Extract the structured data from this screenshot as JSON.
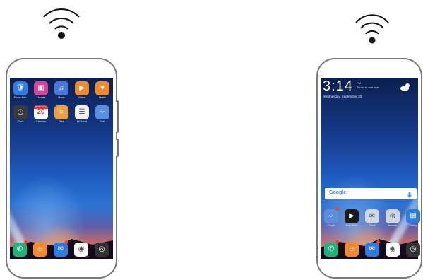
{
  "icons": {
    "wifi": "wifi-icon",
    "weather": "cloud-sun-icon",
    "mic": "microphone-icon"
  },
  "left_phone": {
    "apps_row1": [
      {
        "label": "Phone Man.",
        "icon": "shield-icon",
        "color": "#2f7de1"
      },
      {
        "label": "Themes",
        "icon": "themes-icon",
        "color": "#d6459a"
      },
      {
        "label": "Music",
        "icon": "music-icon",
        "color": "#4a78d8"
      },
      {
        "label": "Videos",
        "icon": "play-icon",
        "color": "#f08a2c"
      },
      {
        "label": "Health",
        "icon": "heart-icon",
        "color": "#f08a2c"
      }
    ],
    "apps_row2": [
      {
        "label": "Clock",
        "icon": "clock-icon",
        "color": "#3a3a3a"
      },
      {
        "label": "Calendar",
        "icon": "calendar-icon",
        "color": "#ffffff",
        "glyph_top": "Wednesday",
        "glyph": "20"
      },
      {
        "label": "Files",
        "icon": "folder-icon",
        "color": "#f0a03a"
      },
      {
        "label": "Hi Board",
        "icon": "notepad-icon",
        "color": "#f2f2f2"
      },
      {
        "label": "Tools",
        "icon": "tools-folder-icon",
        "color": "#5a8fe0"
      }
    ],
    "dock": [
      {
        "icon": "phone-call-icon",
        "color": "#23b07a"
      },
      {
        "icon": "contacts-icon",
        "color": "#f08a2c"
      },
      {
        "icon": "messages-icon",
        "color": "#2f7de1"
      },
      {
        "icon": "chrome-icon",
        "color": "#ffffff"
      },
      {
        "icon": "camera-icon",
        "color": "#333333"
      }
    ]
  },
  "right_phone": {
    "time": "3:14",
    "time_suffix": "PM",
    "unlock_hint": "Touch to add lock",
    "date": "Wednesday, September 20",
    "search_brand": "Google",
    "apps_row": [
      {
        "label": "Google",
        "icon": "google-folder-icon",
        "color": "#5a8fe0"
      },
      {
        "label": "Play Store",
        "icon": "play-store-icon",
        "color": "#1a1a1a"
      },
      {
        "label": "Email",
        "icon": "mail-icon",
        "color": "#cfd6e4"
      },
      {
        "label": "Browser",
        "icon": "browser-icon",
        "color": "#cfd6e4"
      },
      {
        "label": "Gallery",
        "icon": "gallery-icon",
        "color": "#2f7de1"
      }
    ],
    "dock": [
      {
        "icon": "phone-call-icon",
        "color": "#23b07a"
      },
      {
        "icon": "contacts-icon",
        "color": "#f08a2c"
      },
      {
        "icon": "messages-icon",
        "color": "#2f7de1"
      },
      {
        "icon": "chrome-icon",
        "color": "#ffffff"
      },
      {
        "icon": "camera-icon",
        "color": "#333333"
      }
    ]
  }
}
